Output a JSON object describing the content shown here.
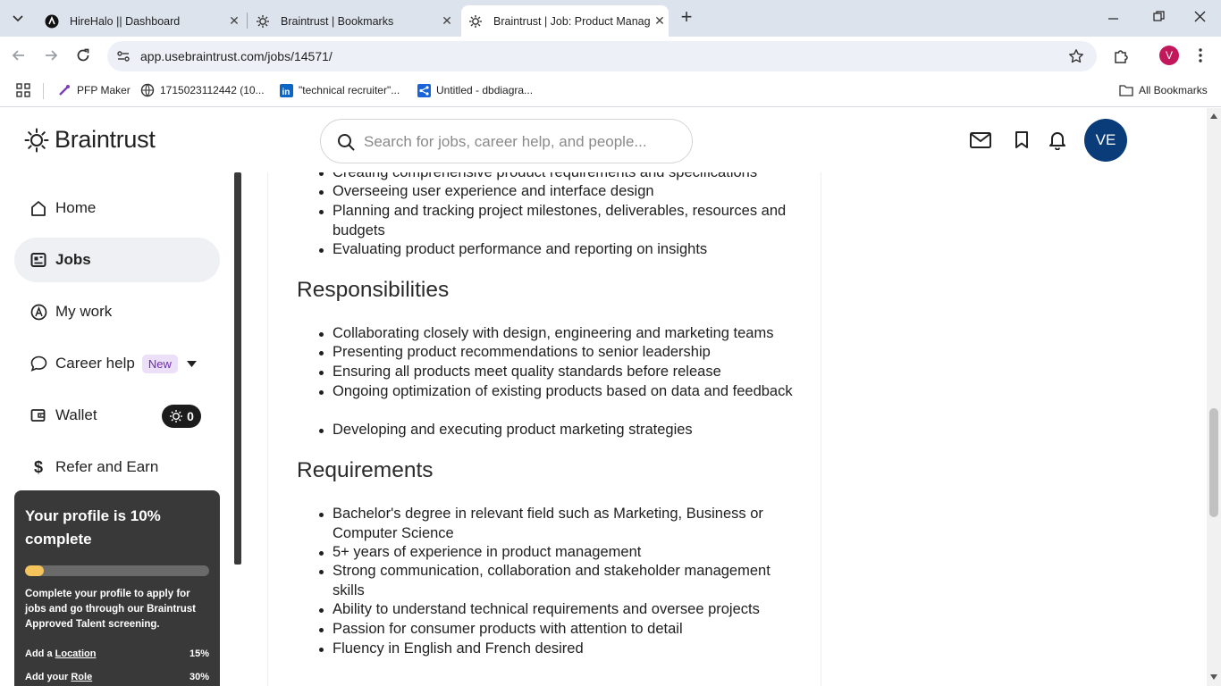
{
  "browser": {
    "tabs": [
      {
        "title": "HireHalo || Dashboard",
        "icon": "hirehalo-favicon"
      },
      {
        "title": "Braintrust | Bookmarks",
        "icon": "braintrust-favicon"
      },
      {
        "title": "Braintrust | Job: Product Manag",
        "icon": "braintrust-favicon"
      }
    ],
    "url": "app.usebraintrust.com/jobs/14571/",
    "profile_initial": "V",
    "bookmarks": [
      {
        "label": "PFP Maker",
        "icon": "pfp-maker-favicon"
      },
      {
        "label": "1715023112442 (10...",
        "icon": "globe-icon"
      },
      {
        "label": "\"technical recruiter\"...",
        "icon": "linkedin-icon"
      },
      {
        "label": "Untitled - dbdiagra...",
        "icon": "dbdiagram-icon"
      }
    ],
    "all_bookmarks_label": "All Bookmarks"
  },
  "header": {
    "logo_text": "Braintrust",
    "search_placeholder": "Search for jobs, career help, and people...",
    "avatar_initials": "VE"
  },
  "sidebar": {
    "items": [
      {
        "label": "Home",
        "icon": "home-icon"
      },
      {
        "label": "Jobs",
        "icon": "jobs-icon",
        "active": true
      },
      {
        "label": "My work",
        "icon": "my-work-icon"
      },
      {
        "label": "Career help",
        "icon": "chat-bubble-icon",
        "badge": "New"
      },
      {
        "label": "Wallet",
        "icon": "wallet-icon",
        "balance": "0"
      },
      {
        "label": "Refer and Earn",
        "icon": "dollar-icon"
      }
    ],
    "profile_card": {
      "title": "Your profile is 10% complete",
      "progress": 0.1,
      "description": "Complete your profile to apply for jobs and go through our Braintrust Approved Talent screening.",
      "rows": [
        {
          "prefix": "Add a ",
          "link": "Location",
          "value": "15%"
        },
        {
          "prefix": "Add your ",
          "link": "Role",
          "value": "30%"
        }
      ]
    }
  },
  "content": {
    "top_bullets": [
      "Creating comprehensive product requirements and specifications",
      "Overseeing user experience and interface design",
      "Planning and tracking project milestones, deliverables, resources and budgets",
      "Evaluating product performance and reporting on insights"
    ],
    "responsibilities_heading": "Responsibilities",
    "responsibilities": [
      "Collaborating closely with design, engineering and marketing teams",
      "Presenting product recommendations to senior leadership",
      "Ensuring all products meet quality standards before release",
      "Ongoing optimization of existing products based on data and feedback",
      "Developing and executing product marketing strategies"
    ],
    "requirements_heading": "Requirements",
    "requirements": [
      "Bachelor's degree in relevant field such as Marketing, Business or Computer Science",
      "5+ years of experience in product management",
      "Strong communication, collaboration and stakeholder management skills",
      "Ability to understand technical requirements and oversee projects",
      "Passion for consumer products with attention to detail",
      "Fluency in English and French desired"
    ]
  },
  "colors": {
    "accent_avatar": "#0b3c7a",
    "progress_fill": "#f4c35c",
    "new_badge_bg": "#ecdff8"
  }
}
